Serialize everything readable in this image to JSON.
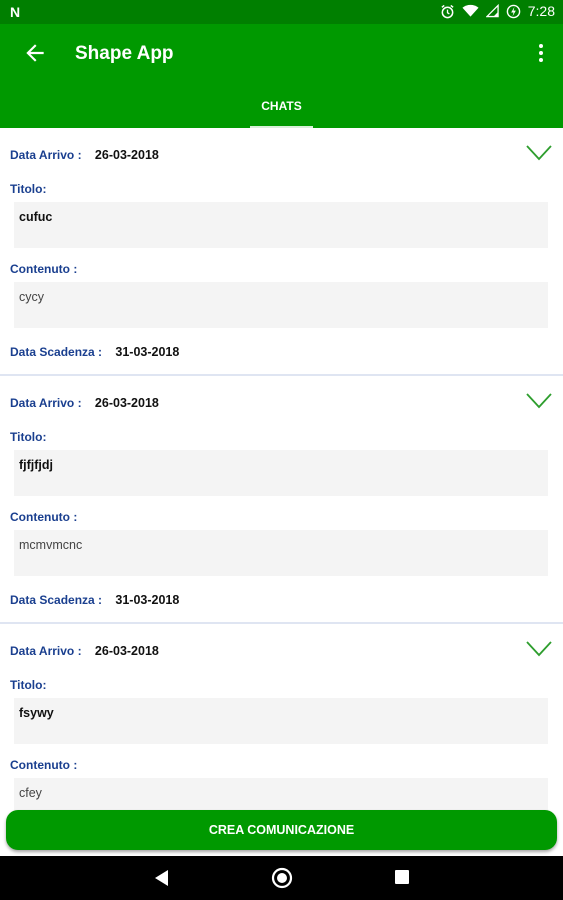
{
  "status": {
    "left_glyph": "N",
    "time": "7:28"
  },
  "appbar": {
    "title": "Shape App"
  },
  "tabs": [
    {
      "label": "CHATS"
    }
  ],
  "labels": {
    "arrivo": "Data Arrivo :",
    "titolo": "Titolo:",
    "contenuto": "Contenuto :",
    "scadenza": "Data Scadenza :"
  },
  "cards": [
    {
      "data_arrivo": "26-03-2018",
      "titolo": "cufuc",
      "contenuto": "cycy",
      "data_scadenza": "31-03-2018"
    },
    {
      "data_arrivo": "26-03-2018",
      "titolo": "fjfjfjdj",
      "contenuto": "mcmvmcnc",
      "data_scadenza": "31-03-2018"
    },
    {
      "data_arrivo": "26-03-2018",
      "titolo": "fsywy",
      "contenuto": "cfey"
    }
  ],
  "fab": {
    "label": "CREA COMUNICAZIONE"
  },
  "colors": {
    "primary": "#009900",
    "primary_dark": "#007f00",
    "label_blue": "#1a3f8f"
  },
  "icons": [
    "back-arrow-icon",
    "more-vert-icon",
    "alarm-icon",
    "wifi-icon",
    "signal-icon",
    "battery-charging-icon",
    "chevron-down-icon",
    "nav-back-icon",
    "nav-home-icon",
    "nav-recents-icon"
  ]
}
